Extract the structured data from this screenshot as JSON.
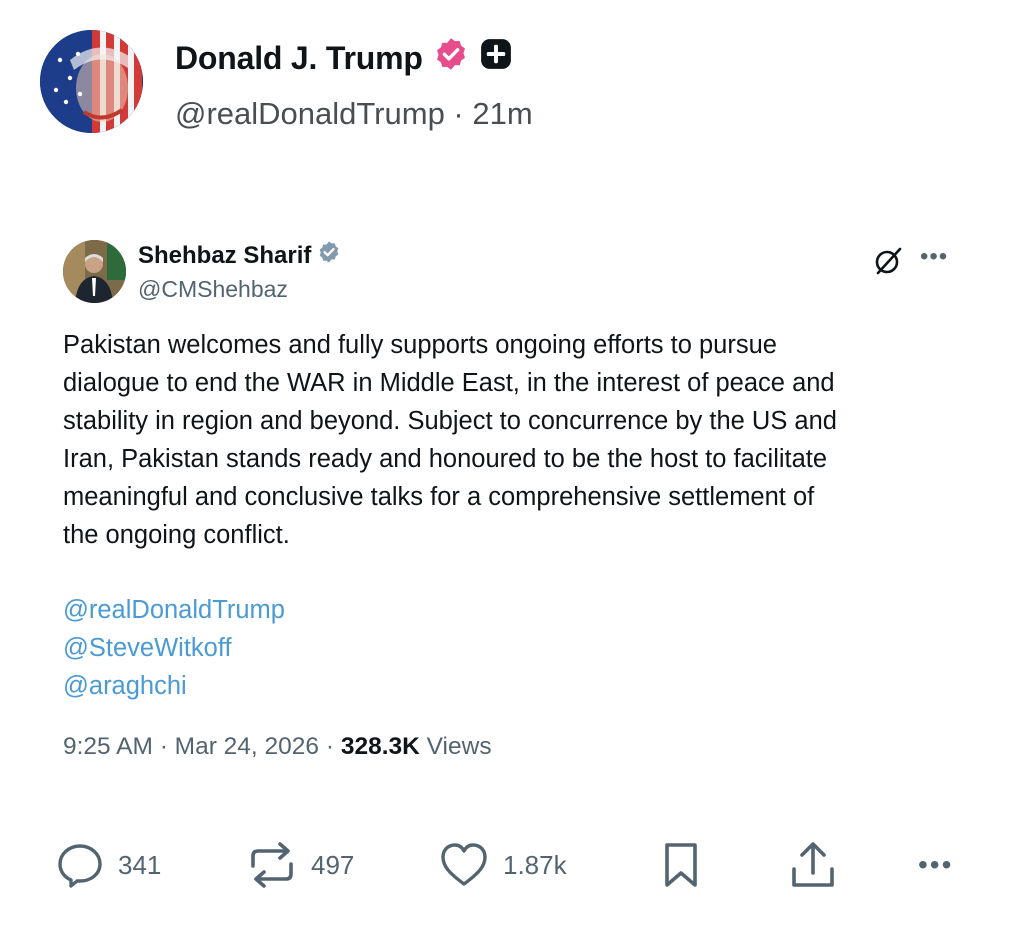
{
  "outer_post": {
    "author_name": "Donald J. Trump",
    "handle": "@realDonaldTrump",
    "separator": " · ",
    "time_ago": "21m",
    "icons": [
      "verified-badge-icon",
      "plus-icon",
      "avatar-flag-portrait"
    ],
    "badge_color": "#e74c8c"
  },
  "quoted_post": {
    "author_name": "Shehbaz Sharif",
    "handle": "@CMShehbaz",
    "text": "Pakistan welcomes and fully supports ongoing efforts to pursue\ndialogue to end the WAR in Middle East, in the interest of peace and\nstability in region and beyond. Subject to concurrence by the US and\nIran, Pakistan stands ready and honoured to be the host to facilitate\nmeaningful and conclusive talks for a comprehensive settlement of\nthe ongoing conflict.",
    "mentions": [
      "@realDonaldTrump",
      "@SteveWitkoff",
      "@araghchi"
    ],
    "time": "9:25 AM",
    "date": "Mar 24, 2026",
    "views_count": "328.3K",
    "views_label": "Views",
    "more_label": "•••",
    "icons": [
      "verified-badge-icon",
      "grok-icon",
      "more-icon"
    ],
    "mention_color": "#4a9ad6"
  },
  "actions": {
    "replies": "341",
    "reposts": "497",
    "likes": "1.87k",
    "more_label": "•••"
  }
}
